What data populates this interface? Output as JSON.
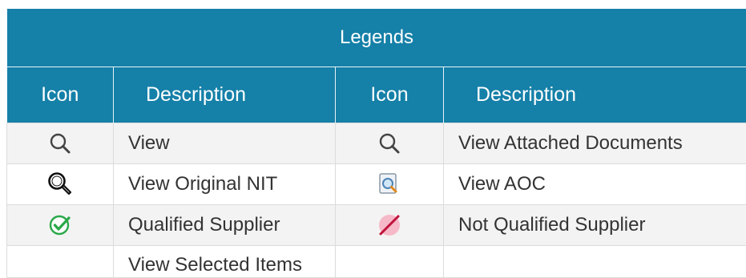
{
  "legends": {
    "title": "Legends",
    "headers": [
      "Icon",
      "Description",
      "Icon",
      "Description"
    ],
    "rows": [
      {
        "left_icon": "search-icon",
        "left_label": "View",
        "right_icon": "search-icon",
        "right_label": "View Attached Documents"
      },
      {
        "left_icon": "magnifier-outline-icon",
        "left_label": "View Original NIT",
        "right_icon": "document-magnifier-icon",
        "right_label": "View AOC"
      },
      {
        "left_icon": "green-check-circle-icon",
        "left_label": "Qualified Supplier",
        "right_icon": "red-prohibited-icon",
        "right_label": "Not Qualified Supplier"
      },
      {
        "left_icon": "",
        "left_label": "View Selected Items",
        "right_icon": "",
        "right_label": ""
      }
    ]
  },
  "colors": {
    "header_bg": "#1580a8",
    "row_shade": "#f3f3f3",
    "check_green": "#2aa84a",
    "no_red": "#c1123a"
  }
}
